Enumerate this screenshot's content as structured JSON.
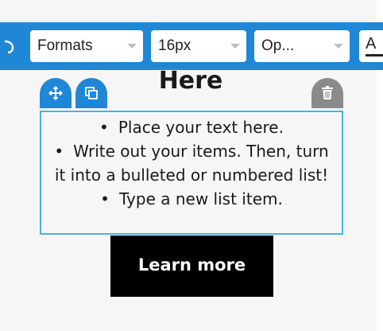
{
  "toolbar": {
    "undo_icon": "undo-icon",
    "format_select": {
      "value": "Formats"
    },
    "size_select": {
      "value": "16px"
    },
    "font_select": {
      "value": "Op..."
    },
    "text_color_glyph": "A",
    "colors": {
      "background": "#1f87d6"
    }
  },
  "content": {
    "heading": "Here",
    "list_items": [
      "Place your text here.",
      "Write out your items. Then, turn it into a bulleted or numbered list!",
      "Type a new list item."
    ],
    "bullet": "•",
    "button_label": "Learn more"
  },
  "block_controls": {
    "move_icon": "move-icon",
    "duplicate_icon": "duplicate-icon",
    "delete_icon": "trash-icon",
    "colors": {
      "primary": "#1f87d6",
      "delete": "#8a8a8a",
      "outline": "#42b4e6"
    }
  }
}
